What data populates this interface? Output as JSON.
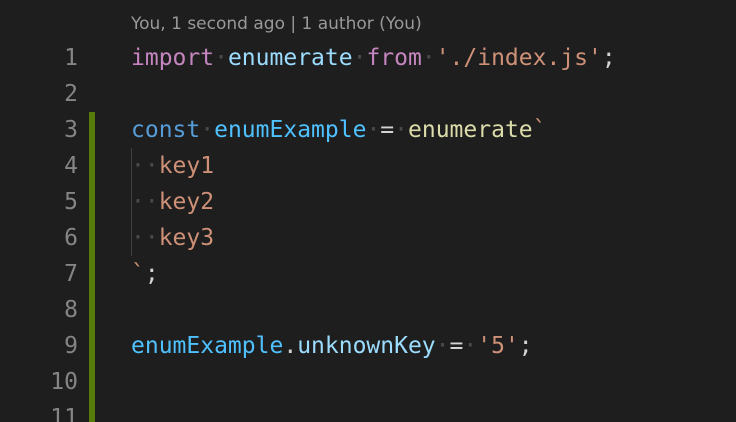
{
  "codelens": {
    "text": "You, 1 second ago | 1 author (You)"
  },
  "lines": [
    {
      "n": "1",
      "tokens": [
        {
          "t": "import",
          "k": "kw"
        },
        {
          "t": "·",
          "k": "ws"
        },
        {
          "t": "enumerate",
          "k": "var"
        },
        {
          "t": "·",
          "k": "ws"
        },
        {
          "t": "from",
          "k": "kw"
        },
        {
          "t": "·",
          "k": "ws"
        },
        {
          "t": "'./index.js'",
          "k": "str"
        },
        {
          "t": ";",
          "k": "punc"
        }
      ]
    },
    {
      "n": "2",
      "tokens": []
    },
    {
      "n": "3",
      "tokens": [
        {
          "t": "const",
          "k": "kw-blue"
        },
        {
          "t": "·",
          "k": "ws"
        },
        {
          "t": "enumExample",
          "k": "const"
        },
        {
          "t": "·",
          "k": "ws"
        },
        {
          "t": "=",
          "k": "punc"
        },
        {
          "t": "·",
          "k": "ws"
        },
        {
          "t": "enumerate",
          "k": "fn"
        },
        {
          "t": "`",
          "k": "str"
        }
      ]
    },
    {
      "n": "4",
      "tokens": [
        {
          "t": "··",
          "k": "ws"
        },
        {
          "t": "key1",
          "k": "str"
        }
      ]
    },
    {
      "n": "5",
      "tokens": [
        {
          "t": "··",
          "k": "ws"
        },
        {
          "t": "key2",
          "k": "str"
        }
      ]
    },
    {
      "n": "6",
      "tokens": [
        {
          "t": "··",
          "k": "ws"
        },
        {
          "t": "key3",
          "k": "str"
        }
      ]
    },
    {
      "n": "7",
      "tokens": [
        {
          "t": "`",
          "k": "str"
        },
        {
          "t": ";",
          "k": "punc"
        }
      ]
    },
    {
      "n": "8",
      "tokens": []
    },
    {
      "n": "9",
      "tokens": [
        {
          "t": "enumExample",
          "k": "const"
        },
        {
          "t": ".",
          "k": "punc"
        },
        {
          "t": "unknownKey",
          "k": "var"
        },
        {
          "t": "·",
          "k": "ws"
        },
        {
          "t": "=",
          "k": "punc"
        },
        {
          "t": "·",
          "k": "ws"
        },
        {
          "t": "'5'",
          "k": "str"
        },
        {
          "t": ";",
          "k": "punc"
        }
      ]
    },
    {
      "n": "10",
      "tokens": []
    },
    {
      "n": "11",
      "tokens": []
    }
  ],
  "colors": {
    "background": "#1e1e1e",
    "git_added": "#587c0c",
    "line_number": "#858585",
    "keyword": "#c586c0",
    "storage": "#569cd6",
    "variable": "#9cdcfe",
    "constant": "#4fc1ff",
    "function": "#dcdcaa",
    "string": "#ce9178"
  }
}
